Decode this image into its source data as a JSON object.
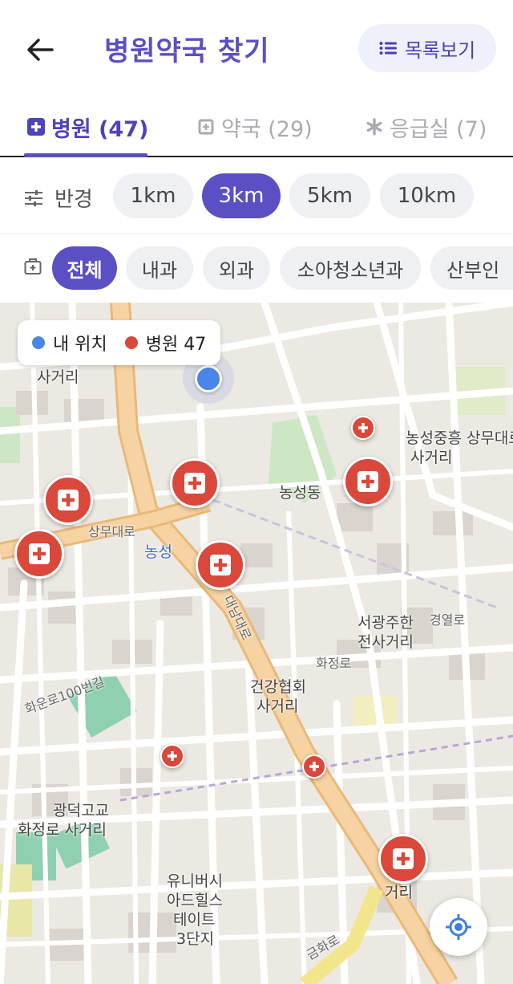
{
  "header": {
    "title": "병원약국 찾기",
    "list_button_label": "목록보기"
  },
  "tabs": [
    {
      "label": "병원 (47)",
      "icon": "hospital-cross-icon",
      "active": true
    },
    {
      "label": "약국 (29)",
      "icon": "pharmacy-icon",
      "active": false
    },
    {
      "label": "응급실 (7)",
      "icon": "emergency-asterisk-icon",
      "active": false
    }
  ],
  "radius": {
    "label": "반경",
    "options": [
      "1km",
      "3km",
      "5km",
      "10km"
    ],
    "selected": "3km"
  },
  "departments": {
    "options": [
      "전체",
      "내과",
      "외과",
      "소아청소년과",
      "산부인"
    ],
    "selected": "전체"
  },
  "legend": {
    "my_location": "내 위치",
    "hospital": "병원 47"
  },
  "map_labels": {
    "nongseong_dong": "농성동",
    "nongseong_station": "농성",
    "sangmu_daero": "상무대로",
    "daenam_daero": "대남대로",
    "nongseong_intersection": "농성중흥 상무대로",
    "sageori_1": "사거리",
    "seogwang_intersection": "서광주한",
    "jeonsa_intersection": "전사거리",
    "geongang_intersection": "건강협회",
    "sageori_2": "사거리",
    "gwangdeok": "광덕고교",
    "hwajeong_intersection": "화정로 사거리",
    "universe_apt_1": "유니버시",
    "universe_apt_2": "아드힐스",
    "universe_apt_3": "테이트",
    "universe_apt_4": "3단지",
    "gyeongyeol_ro": "경열로",
    "hwajeong_ro": "화정로",
    "geumhwa_ro": "금화로",
    "sageori_3": "사거리",
    "sageori_4": "거리",
    "hwaun_ro": "화운로100번길"
  },
  "colors": {
    "accent": "#5b4fc4",
    "hospital_marker": "#d9483b",
    "my_location": "#4a86e8"
  }
}
